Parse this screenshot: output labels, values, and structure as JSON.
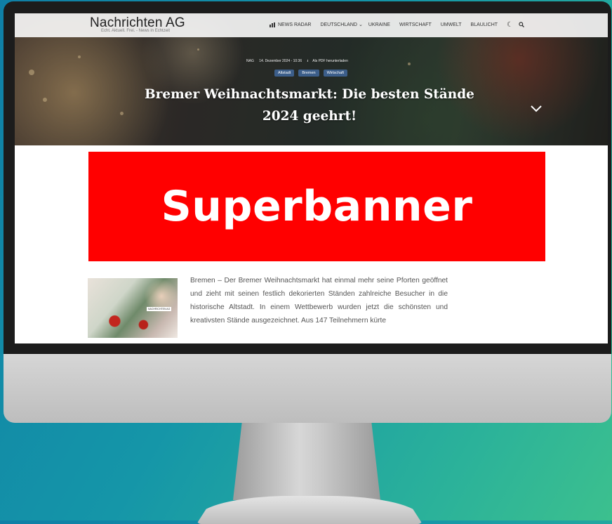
{
  "site": {
    "logo_title": "Nachrichten AG",
    "logo_tagline": "Echt. Aktuell. Frei. - News in Echtzeit"
  },
  "nav": {
    "items": [
      {
        "label": "NEWS RADAR",
        "icon": "radar-icon"
      },
      {
        "label": "DEUTSCHLAND",
        "icon": "chevron-down-icon"
      },
      {
        "label": "UKRAINE"
      },
      {
        "label": "WIRTSCHAFT"
      },
      {
        "label": "UMWELT"
      },
      {
        "label": "BLAULICHT"
      }
    ],
    "theme_toggle_icon": "moon-icon",
    "search_icon": "search-icon"
  },
  "article": {
    "author": "NAG",
    "date": "14. Dezember 2024 - 10:36",
    "pdf_label": "Als PDF herunterladen",
    "tags": [
      "Altstadt",
      "Bremen",
      "Wirtschaft"
    ],
    "headline_line1": "Bremer Weihnachtsmarkt: Die besten Stände",
    "headline_line2": "2024 geehrt!",
    "image_label": "NACHRICHTEN AG",
    "body": "Bremen – Der Bremer Weihnachtsmarkt hat einmal mehr seine Pforten geöffnet und zieht mit seinen festlich dekorierten Ständen zahlreiche Besucher in die historische Altstadt. In einem Wettbewerb wurden jetzt die schönsten und kreativsten Stände ausgezeichnet. Aus 147 Teilnehmern kürte"
  },
  "ad": {
    "label": "Superbanner",
    "background": "#ff0000"
  },
  "colors": {
    "background_gradient_start": "#0f7fa6",
    "background_gradient_end": "#3cc08e",
    "tag_bg": "#3c5e8a"
  }
}
